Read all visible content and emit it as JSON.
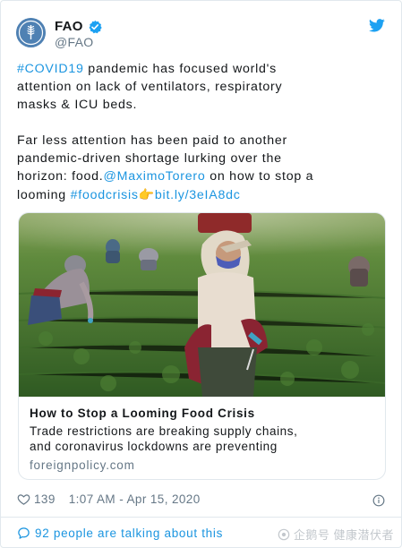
{
  "account": {
    "name": "FAO",
    "handle": "@FAO"
  },
  "tweet": {
    "line1": {
      "hashtag": "#COVID19",
      "text": " pandemic has focused world's"
    },
    "line2": "attention on lack of ventilators, respiratory",
    "line3": "masks & ICU beds.",
    "line4": "Far less attention has been paid to another",
    "line5": "pandemic-driven shortage lurking over the",
    "line6": {
      "text": "horizon: food.",
      "mention": "@MaximoTorero",
      "text2": " on how to stop a"
    },
    "line7": {
      "text": "looming ",
      "hashtag": "#foodcrisis",
      "emoji": "👉",
      "link": "bit.ly/3eIA8dc"
    }
  },
  "card": {
    "title": "How to Stop a Looming Food Crisis",
    "desc1": "Trade restrictions are breaking supply chains,",
    "desc2": "and coronavirus lockdowns are preventing",
    "domain": "foreignpolicy.com"
  },
  "meta": {
    "likes": "139",
    "timestamp": "1:07 AM - Apr 15, 2020"
  },
  "footer": {
    "talking": "92 people are talking about this"
  },
  "watermark": {
    "text": "企鹅号 健康潜伏者"
  },
  "colors": {
    "link": "#1b95e0",
    "text": "#14171a",
    "secondary": "#657786",
    "border": "#e1e8ed"
  }
}
